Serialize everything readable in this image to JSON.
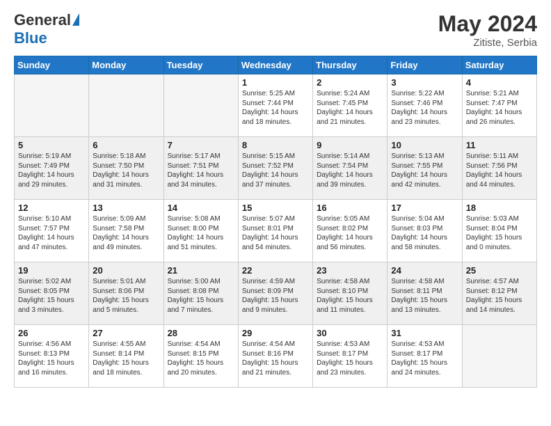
{
  "header": {
    "logo_general": "General",
    "logo_blue": "Blue",
    "month_year": "May 2024",
    "location": "Zitiste, Serbia"
  },
  "days_of_week": [
    "Sunday",
    "Monday",
    "Tuesday",
    "Wednesday",
    "Thursday",
    "Friday",
    "Saturday"
  ],
  "weeks": [
    [
      {
        "day": "",
        "info": ""
      },
      {
        "day": "",
        "info": ""
      },
      {
        "day": "",
        "info": ""
      },
      {
        "day": "1",
        "info": "Sunrise: 5:25 AM\nSunset: 7:44 PM\nDaylight: 14 hours\nand 18 minutes."
      },
      {
        "day": "2",
        "info": "Sunrise: 5:24 AM\nSunset: 7:45 PM\nDaylight: 14 hours\nand 21 minutes."
      },
      {
        "day": "3",
        "info": "Sunrise: 5:22 AM\nSunset: 7:46 PM\nDaylight: 14 hours\nand 23 minutes."
      },
      {
        "day": "4",
        "info": "Sunrise: 5:21 AM\nSunset: 7:47 PM\nDaylight: 14 hours\nand 26 minutes."
      }
    ],
    [
      {
        "day": "5",
        "info": "Sunrise: 5:19 AM\nSunset: 7:49 PM\nDaylight: 14 hours\nand 29 minutes."
      },
      {
        "day": "6",
        "info": "Sunrise: 5:18 AM\nSunset: 7:50 PM\nDaylight: 14 hours\nand 31 minutes."
      },
      {
        "day": "7",
        "info": "Sunrise: 5:17 AM\nSunset: 7:51 PM\nDaylight: 14 hours\nand 34 minutes."
      },
      {
        "day": "8",
        "info": "Sunrise: 5:15 AM\nSunset: 7:52 PM\nDaylight: 14 hours\nand 37 minutes."
      },
      {
        "day": "9",
        "info": "Sunrise: 5:14 AM\nSunset: 7:54 PM\nDaylight: 14 hours\nand 39 minutes."
      },
      {
        "day": "10",
        "info": "Sunrise: 5:13 AM\nSunset: 7:55 PM\nDaylight: 14 hours\nand 42 minutes."
      },
      {
        "day": "11",
        "info": "Sunrise: 5:11 AM\nSunset: 7:56 PM\nDaylight: 14 hours\nand 44 minutes."
      }
    ],
    [
      {
        "day": "12",
        "info": "Sunrise: 5:10 AM\nSunset: 7:57 PM\nDaylight: 14 hours\nand 47 minutes."
      },
      {
        "day": "13",
        "info": "Sunrise: 5:09 AM\nSunset: 7:58 PM\nDaylight: 14 hours\nand 49 minutes."
      },
      {
        "day": "14",
        "info": "Sunrise: 5:08 AM\nSunset: 8:00 PM\nDaylight: 14 hours\nand 51 minutes."
      },
      {
        "day": "15",
        "info": "Sunrise: 5:07 AM\nSunset: 8:01 PM\nDaylight: 14 hours\nand 54 minutes."
      },
      {
        "day": "16",
        "info": "Sunrise: 5:05 AM\nSunset: 8:02 PM\nDaylight: 14 hours\nand 56 minutes."
      },
      {
        "day": "17",
        "info": "Sunrise: 5:04 AM\nSunset: 8:03 PM\nDaylight: 14 hours\nand 58 minutes."
      },
      {
        "day": "18",
        "info": "Sunrise: 5:03 AM\nSunset: 8:04 PM\nDaylight: 15 hours\nand 0 minutes."
      }
    ],
    [
      {
        "day": "19",
        "info": "Sunrise: 5:02 AM\nSunset: 8:05 PM\nDaylight: 15 hours\nand 3 minutes."
      },
      {
        "day": "20",
        "info": "Sunrise: 5:01 AM\nSunset: 8:06 PM\nDaylight: 15 hours\nand 5 minutes."
      },
      {
        "day": "21",
        "info": "Sunrise: 5:00 AM\nSunset: 8:08 PM\nDaylight: 15 hours\nand 7 minutes."
      },
      {
        "day": "22",
        "info": "Sunrise: 4:59 AM\nSunset: 8:09 PM\nDaylight: 15 hours\nand 9 minutes."
      },
      {
        "day": "23",
        "info": "Sunrise: 4:58 AM\nSunset: 8:10 PM\nDaylight: 15 hours\nand 11 minutes."
      },
      {
        "day": "24",
        "info": "Sunrise: 4:58 AM\nSunset: 8:11 PM\nDaylight: 15 hours\nand 13 minutes."
      },
      {
        "day": "25",
        "info": "Sunrise: 4:57 AM\nSunset: 8:12 PM\nDaylight: 15 hours\nand 14 minutes."
      }
    ],
    [
      {
        "day": "26",
        "info": "Sunrise: 4:56 AM\nSunset: 8:13 PM\nDaylight: 15 hours\nand 16 minutes."
      },
      {
        "day": "27",
        "info": "Sunrise: 4:55 AM\nSunset: 8:14 PM\nDaylight: 15 hours\nand 18 minutes."
      },
      {
        "day": "28",
        "info": "Sunrise: 4:54 AM\nSunset: 8:15 PM\nDaylight: 15 hours\nand 20 minutes."
      },
      {
        "day": "29",
        "info": "Sunrise: 4:54 AM\nSunset: 8:16 PM\nDaylight: 15 hours\nand 21 minutes."
      },
      {
        "day": "30",
        "info": "Sunrise: 4:53 AM\nSunset: 8:17 PM\nDaylight: 15 hours\nand 23 minutes."
      },
      {
        "day": "31",
        "info": "Sunrise: 4:53 AM\nSunset: 8:17 PM\nDaylight: 15 hours\nand 24 minutes."
      },
      {
        "day": "",
        "info": ""
      }
    ]
  ]
}
